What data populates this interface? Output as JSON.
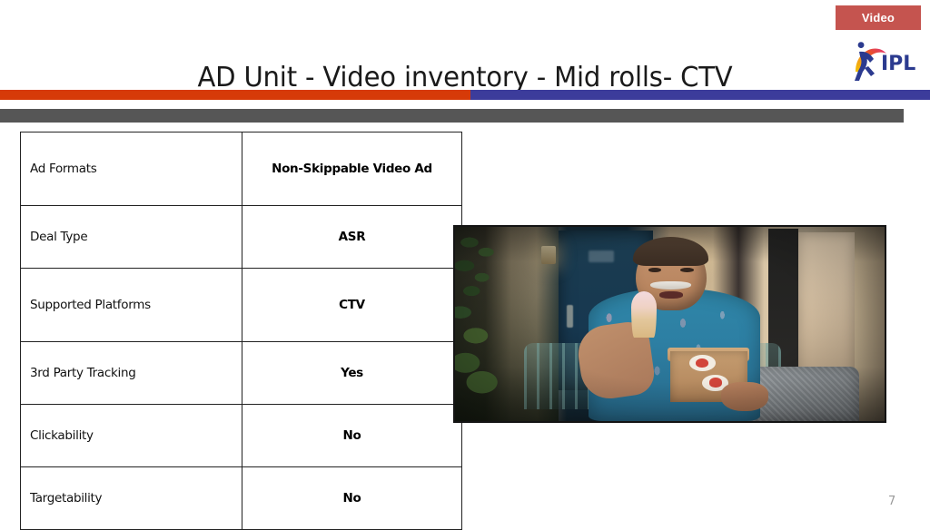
{
  "badge": {
    "label": "Video",
    "color": "#c5544f"
  },
  "logo": {
    "name": "ipl-logo",
    "text": "IPL",
    "colors": {
      "text": "#2b3a8f",
      "swoosh_start": "#f2c200",
      "swoosh_mid": "#ef7d1a",
      "swoosh_end": "#e0317c",
      "figure": "#2b3a8f"
    }
  },
  "title": "AD Unit - Video inventory - Mid rolls- CTV",
  "accent_bars": {
    "left_color": "#d63a08",
    "right_color": "#3c3c9b",
    "gray_color": "#565656"
  },
  "spec_table": {
    "rows": [
      {
        "label": "Ad Formats",
        "value": "Non-Skippable Video Ad"
      },
      {
        "label": "Deal Type",
        "value": "ASR"
      },
      {
        "label": "Supported Platforms",
        "value": "CTV"
      },
      {
        "label": "3rd Party Tracking",
        "value": "Yes"
      },
      {
        "label": "Clickability",
        "value": "No"
      },
      {
        "label": "Targetability",
        "value": "No"
      }
    ]
  },
  "video_still": {
    "name": "ad-creative-still",
    "description": "Man in blue floral shirt eating an ice cream cone and holding a kraft takeaway box on a garden bench"
  },
  "page_number": "7"
}
